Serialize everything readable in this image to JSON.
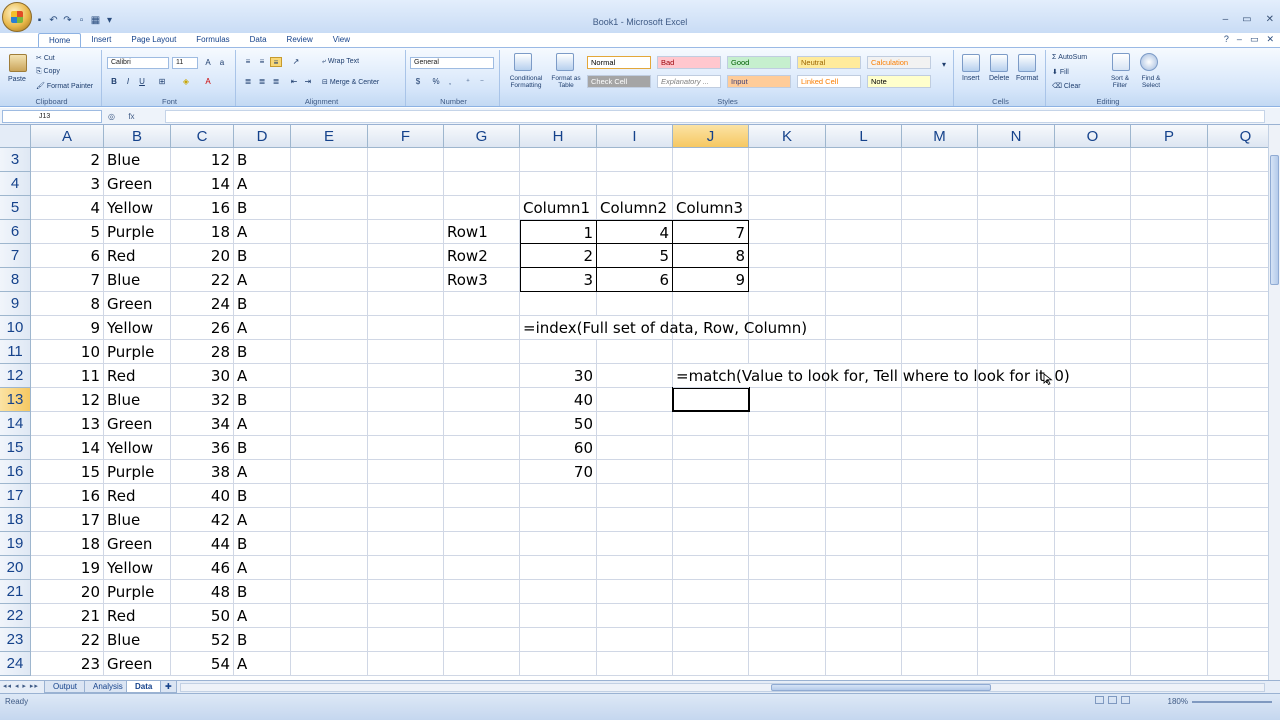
{
  "window": {
    "title": "Book1 - Microsoft Excel",
    "controls": [
      "–",
      "▭",
      "✕"
    ]
  },
  "ribbon_tabs": [
    "Home",
    "Insert",
    "Page Layout",
    "Formulas",
    "Data",
    "Review",
    "View"
  ],
  "active_tab": "Home",
  "clipboard": {
    "label": "Clipboard",
    "paste": "Paste",
    "cut": "Cut",
    "copy": "Copy",
    "format_painter": "Format Painter"
  },
  "font": {
    "label": "Font",
    "name": "Calibri",
    "size": "11",
    "bold": "B",
    "italic": "I",
    "underline": "U"
  },
  "alignment": {
    "label": "Alignment",
    "wrap_text": "Wrap Text",
    "merge_center": "Merge & Center"
  },
  "number": {
    "label": "Number",
    "format": "General",
    "currency": "$",
    "percent": "%",
    "comma": ","
  },
  "styles": {
    "label": "Styles",
    "conditional": "Conditional Formatting",
    "format_table": "Format as Table",
    "cells": [
      {
        "text": "Normal",
        "bg": "#ffffff",
        "fg": "#000000"
      },
      {
        "text": "Bad",
        "bg": "#ffc7ce",
        "fg": "#9c0006"
      },
      {
        "text": "Good",
        "bg": "#c6efce",
        "fg": "#006100"
      },
      {
        "text": "Neutral",
        "bg": "#ffeb9c",
        "fg": "#9c6500"
      },
      {
        "text": "Calculation",
        "bg": "#f2f2f2",
        "fg": "#fa7d00"
      },
      {
        "text": "Check Cell",
        "bg": "#a5a5a5",
        "fg": "#ffffff"
      },
      {
        "text": "Explanatory ...",
        "bg": "#ffffff",
        "fg": "#7f7f7f"
      },
      {
        "text": "Input",
        "bg": "#ffcc99",
        "fg": "#3f3f76"
      },
      {
        "text": "Linked Cell",
        "bg": "#ffffff",
        "fg": "#fa7d00"
      },
      {
        "text": "Note",
        "bg": "#ffffcc",
        "fg": "#000000"
      }
    ]
  },
  "cells_group": {
    "label": "Cells",
    "insert": "Insert",
    "delete": "Delete",
    "format": "Format"
  },
  "editing": {
    "label": "Editing",
    "autosum": "AutoSum",
    "fill": "Fill",
    "clear": "Clear",
    "sort_filter": "Sort & Filter",
    "find_select": "Find & Select"
  },
  "formula_bar": {
    "name_box": "J13",
    "fx": "fx",
    "value": ""
  },
  "columns": [
    "A",
    "B",
    "C",
    "D",
    "E",
    "F",
    "G",
    "H",
    "I",
    "J",
    "K",
    "L",
    "M",
    "N",
    "O",
    "P",
    "Q"
  ],
  "selected_column": "J",
  "selected_row": "13",
  "rows": [
    {
      "n": "3",
      "A": "2",
      "B": "Blue",
      "C": "12",
      "D": "B"
    },
    {
      "n": "4",
      "A": "3",
      "B": "Green",
      "C": "14",
      "D": "A"
    },
    {
      "n": "5",
      "A": "4",
      "B": "Yellow",
      "C": "16",
      "D": "B",
      "H": "Column1",
      "I": "Column2",
      "J": "Column3"
    },
    {
      "n": "6",
      "A": "5",
      "B": "Purple",
      "C": "18",
      "D": "A",
      "G": "Row1",
      "H": "1",
      "I": "4",
      "J": "7"
    },
    {
      "n": "7",
      "A": "6",
      "B": "Red",
      "C": "20",
      "D": "B",
      "G": "Row2",
      "H": "2",
      "I": "5",
      "J": "8"
    },
    {
      "n": "8",
      "A": "7",
      "B": "Blue",
      "C": "22",
      "D": "A",
      "G": "Row3",
      "H": "3",
      "I": "6",
      "J": "9"
    },
    {
      "n": "9",
      "A": "8",
      "B": "Green",
      "C": "24",
      "D": "B"
    },
    {
      "n": "10",
      "A": "9",
      "B": "Yellow",
      "C": "26",
      "D": "A",
      "H": "=index(Full set of data, Row, Column)"
    },
    {
      "n": "11",
      "A": "10",
      "B": "Purple",
      "C": "28",
      "D": "B"
    },
    {
      "n": "12",
      "A": "11",
      "B": "Red",
      "C": "30",
      "D": "A",
      "H": "30",
      "J": "=match(Value to look for, Tell where to look for it, 0)"
    },
    {
      "n": "13",
      "A": "12",
      "B": "Blue",
      "C": "32",
      "D": "B",
      "H": "40"
    },
    {
      "n": "14",
      "A": "13",
      "B": "Green",
      "C": "34",
      "D": "A",
      "H": "50"
    },
    {
      "n": "15",
      "A": "14",
      "B": "Yellow",
      "C": "36",
      "D": "B",
      "H": "60"
    },
    {
      "n": "16",
      "A": "15",
      "B": "Purple",
      "C": "38",
      "D": "A",
      "H": "70"
    },
    {
      "n": "17",
      "A": "16",
      "B": "Red",
      "C": "40",
      "D": "B"
    },
    {
      "n": "18",
      "A": "17",
      "B": "Blue",
      "C": "42",
      "D": "A"
    },
    {
      "n": "19",
      "A": "18",
      "B": "Green",
      "C": "44",
      "D": "B"
    },
    {
      "n": "20",
      "A": "19",
      "B": "Yellow",
      "C": "46",
      "D": "A"
    },
    {
      "n": "21",
      "A": "20",
      "B": "Purple",
      "C": "48",
      "D": "B"
    },
    {
      "n": "22",
      "A": "21",
      "B": "Red",
      "C": "50",
      "D": "A"
    },
    {
      "n": "23",
      "A": "22",
      "B": "Blue",
      "C": "52",
      "D": "B"
    },
    {
      "n": "24",
      "A": "23",
      "B": "Green",
      "C": "54",
      "D": "A"
    }
  ],
  "sheets": [
    "Output",
    "Analysis",
    "Data"
  ],
  "active_sheet": "Data",
  "status": {
    "text": "Ready",
    "zoom": "180%"
  }
}
